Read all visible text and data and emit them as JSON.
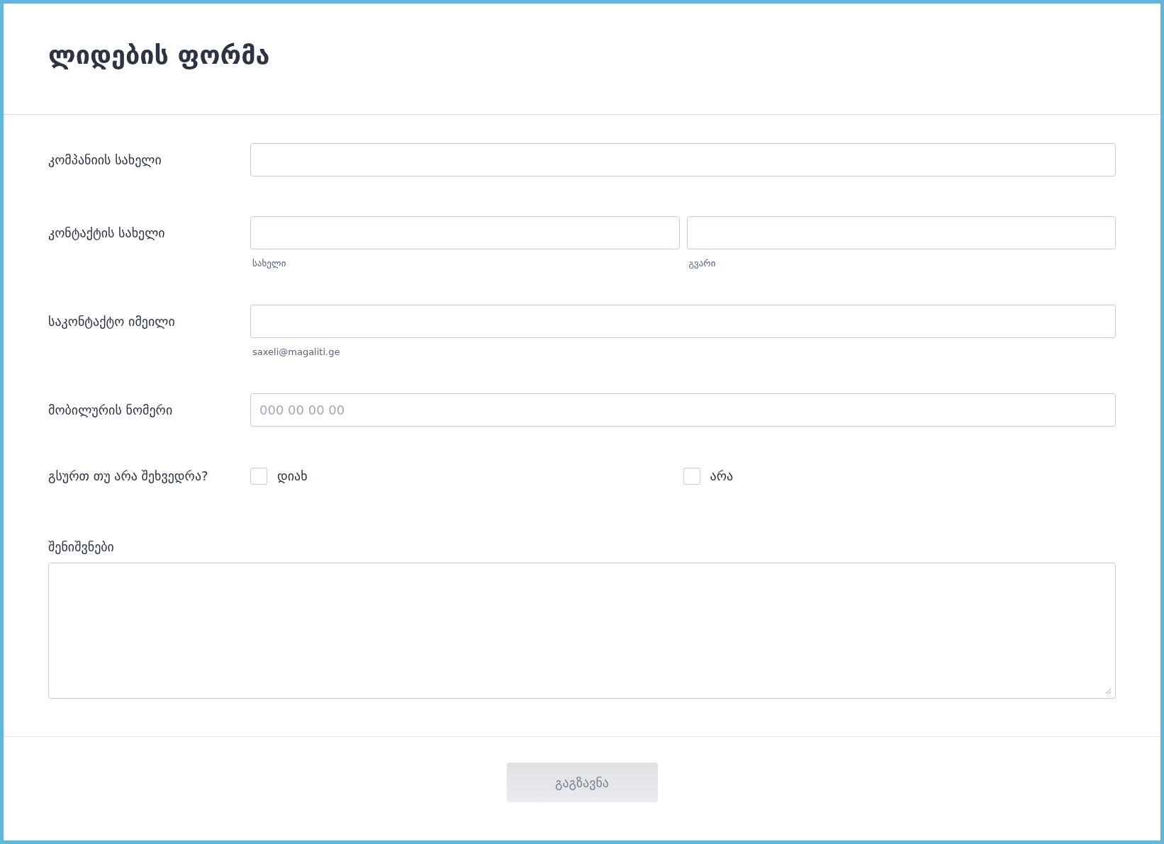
{
  "form": {
    "title": "ლიდების ფორმა",
    "fields": [
      {
        "kind": "text",
        "label": "კომპანიის სახელი"
      },
      {
        "kind": "name",
        "label": "კონტაქტის სახელი",
        "parts": [
          {
            "sublabel": "სახელი"
          },
          {
            "sublabel": "გვარი"
          }
        ]
      },
      {
        "kind": "email",
        "label": "საკონტაქტო იმეილი",
        "sublabel": "saxeli@magaliti.ge"
      },
      {
        "kind": "phone",
        "label": "მობილურის ნომერი",
        "placeholder": "000 00 00 00"
      },
      {
        "kind": "checks",
        "label": "გსურთ თუ არა შეხვედრა?",
        "options": [
          {
            "label": "დიახ",
            "checked": false
          },
          {
            "label": "არა",
            "checked": false
          }
        ]
      },
      {
        "kind": "textarea",
        "label": "შენიშვნები"
      }
    ],
    "submit": {
      "label": "გაგზავნა",
      "disabled": true
    }
  }
}
